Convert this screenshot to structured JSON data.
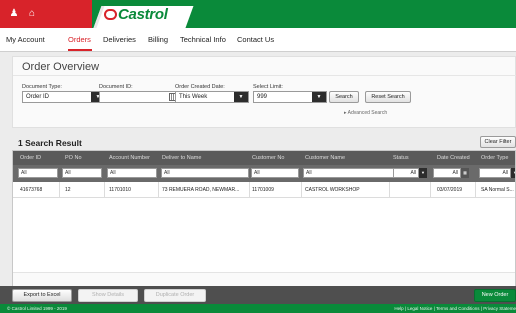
{
  "brand": {
    "logo_text": "Castrol",
    "primary_green": "#0a8a3a",
    "primary_red": "#d8232a"
  },
  "topbar": {
    "icons": [
      "user-icon",
      "home-icon"
    ]
  },
  "nav": {
    "items": [
      {
        "label": "My Account"
      },
      {
        "label": "Orders",
        "active": true
      },
      {
        "label": "Deliveries"
      },
      {
        "label": "Billing"
      },
      {
        "label": "Technical Info"
      },
      {
        "label": "Contact Us"
      }
    ]
  },
  "overview": {
    "title": "Order Overview",
    "document_type": {
      "label": "Document Type:",
      "value": "Order ID"
    },
    "document_id": {
      "label": "Document ID:",
      "value": ""
    },
    "order_created_date": {
      "label": "Order Created Date:",
      "value": "This Week"
    },
    "select_limit": {
      "label": "Select Limit:",
      "value": "999"
    },
    "search_label": "Search",
    "reset_label": "Reset Search",
    "advanced_label": "Advanced Search"
  },
  "results": {
    "title": "1 Search Result",
    "clear_filter_label": "Clear Filter",
    "columns": [
      "Order ID",
      "PO No",
      "Account Number",
      "Deliver to Name",
      "Customer No",
      "Customer Name",
      "Status",
      "Date Created",
      "Order Type"
    ],
    "filters": [
      "All",
      "All",
      "All",
      "All",
      "All",
      "All",
      "All",
      "All",
      "All"
    ],
    "rows": [
      {
        "order_id": "41673768",
        "po_no": "12",
        "account_number": "11701010",
        "deliver_to_name": "73 REMUERA ROAD, NEWMAR...",
        "customer_no": "11701009",
        "customer_name": "CASTROL WORKSHOP",
        "status": "",
        "date_created": "03/07/2019",
        "order_type": "SA Normal S..."
      }
    ]
  },
  "actions": {
    "export_label": "Export to Excel",
    "show_details_label": "Show Details",
    "duplicate_label": "Duplicate Order",
    "new_order_label": "New Order"
  },
  "footer": {
    "copyright": "© Castrol Limited 1999 - 2019",
    "links": [
      "Help",
      "Legal Notice",
      "Terms and Conditions",
      "Privacy Stateme"
    ]
  }
}
